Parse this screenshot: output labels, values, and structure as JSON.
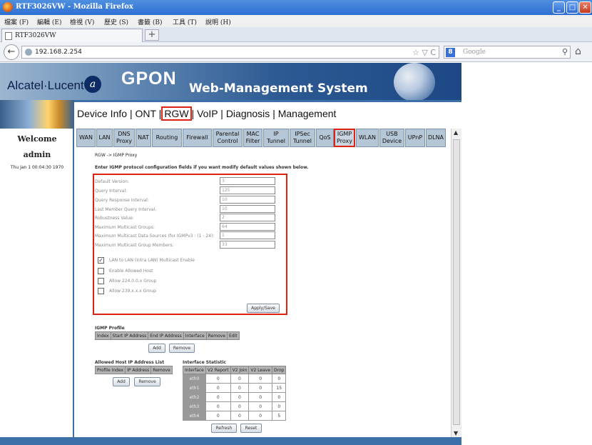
{
  "window": {
    "title": "RTF3026VW - Mozilla Firefox",
    "min": "_",
    "max": "□",
    "close": "✕"
  },
  "menu": [
    "檔案 (F)",
    "編輯 (E)",
    "檢視 (V)",
    "歷史 (S)",
    "書籤 (B)",
    "工具 (T)",
    "說明 (H)"
  ],
  "tab": {
    "label": "RTF3026VW",
    "new_tab": "+"
  },
  "address": {
    "url": "192.168.2.254",
    "star": "☆ ▽ C"
  },
  "search": {
    "engine": "8",
    "placeholder": "Google"
  },
  "banner": {
    "logo": "Alcatel·Lucent",
    "title": "GPON",
    "subtitle": "Web-Management System"
  },
  "sidebar": {
    "welcome": "Welcome",
    "user": "admin",
    "time": "Thu Jan 1 00:04:30 1970"
  },
  "topnav": {
    "device_info": "Device Info",
    "ont": "ONT",
    "rgw": "RGW",
    "voip": "VoIP",
    "diagnosis": "Diagnosis",
    "management": "Management",
    "sep": "|"
  },
  "tabs": [
    "WAN",
    "LAN",
    "DNS Proxy",
    "NAT",
    "Routing",
    "Firewall",
    "Parental Control",
    "MAC Filter",
    "IP Tunnel",
    "IPSec Tunnel",
    "QoS",
    "IGMP Proxy",
    "WLAN",
    "USB Device",
    "UPnP",
    "DLNA"
  ],
  "selected_tab": "IGMP Proxy",
  "breadcrumb": "RGW -> IGMP Proxy",
  "intro": "Enter IGMP protocol configuration fields if you want modify default values shown below.",
  "fields": [
    {
      "label": "Default Version:",
      "value": "3"
    },
    {
      "label": "Query Interval:",
      "value": "125"
    },
    {
      "label": "Query Response Interval:",
      "value": "10"
    },
    {
      "label": "Last Member Query Interval:",
      "value": "10"
    },
    {
      "label": "Robustness Value:",
      "value": "2"
    },
    {
      "label": "Maximum Multicast Groups:",
      "value": "64"
    },
    {
      "label": "Maximum Multicast Data Sources (for IGMPv3 : (1 - 24):",
      "value": "1"
    },
    {
      "label": "Maximum Multicast Group Members:",
      "value": "33"
    }
  ],
  "checkboxes": [
    {
      "label": "LAN to LAN (Intra LAN) Multicast Enable",
      "checked": true
    },
    {
      "label": "Enable Allowed Host",
      "checked": false
    },
    {
      "label": "Allow 224.0.0.x Group",
      "checked": false
    },
    {
      "label": "Allow 239.x.x.x Group",
      "checked": false
    }
  ],
  "apply_label": "Apply/Save",
  "igmp_profile": {
    "title": "IGMP Profile",
    "columns": [
      "Index",
      "Start IP Address",
      "End IP Address",
      "Interface",
      "Remove",
      "Edit"
    ],
    "add": "Add",
    "remove": "Remove"
  },
  "allowed_host": {
    "title": "Allowed Host IP Address List",
    "columns": [
      "Profile Index",
      "IP Address",
      "Remove"
    ],
    "add": "Add",
    "remove": "Remove"
  },
  "interface_stat": {
    "title": "Interface Statistic",
    "columns": [
      "Interface",
      "V2 Report",
      "V2 Join",
      "V2 Leave",
      "Drop"
    ],
    "rows": [
      [
        "eth0",
        "0",
        "0",
        "0",
        "0"
      ],
      [
        "eth1",
        "0",
        "0",
        "0",
        "15"
      ],
      [
        "eth2",
        "0",
        "0",
        "0",
        "0"
      ],
      [
        "eth3",
        "0",
        "0",
        "0",
        "0"
      ],
      [
        "eth4",
        "0",
        "0",
        "0",
        "5"
      ]
    ],
    "refresh": "Refresh",
    "reset": "Reset"
  },
  "colors": {
    "highlight": "#dd2211",
    "tab_bg": "#b5c6d6",
    "banner": "#2d5a93"
  }
}
